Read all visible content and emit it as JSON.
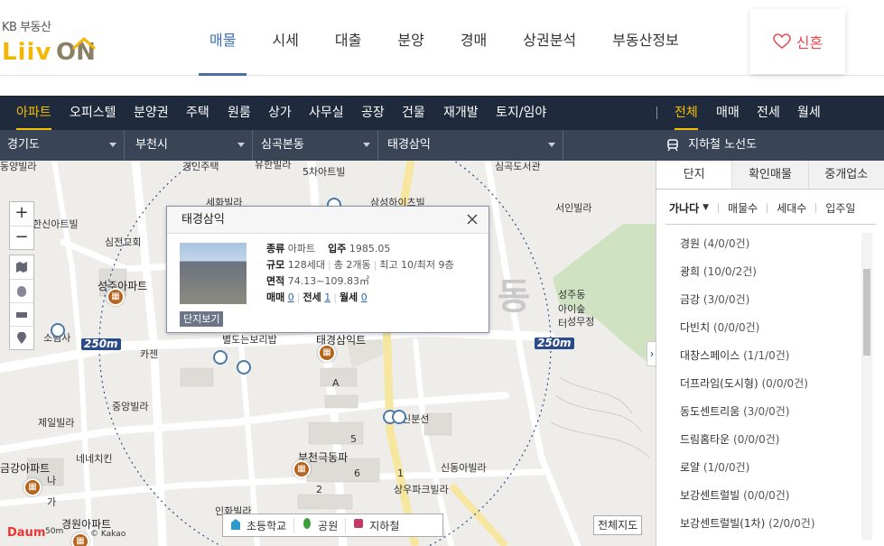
{
  "header": {
    "logo_kb": "KB 부동산",
    "logo_liiv": "Liiv",
    "logo_on": "ON",
    "nav": [
      "매물",
      "시세",
      "대출",
      "분양",
      "경매",
      "상권분석",
      "부동산정보"
    ],
    "active_nav": "매물",
    "user_label": "신혼"
  },
  "categories": {
    "items": [
      "아파트",
      "오피스텔",
      "분양권",
      "주택",
      "원룸",
      "상가",
      "사무실",
      "공장",
      "건물",
      "재개발",
      "토지/임야"
    ],
    "active": "아파트",
    "deal_types": [
      "전체",
      "매매",
      "전세",
      "월세"
    ],
    "active_deal": "전체"
  },
  "filters": {
    "sido": "경기도",
    "sigungu": "부천시",
    "dong": "심곡본동",
    "complex": "태경삼익",
    "subway": "지하철 노선도"
  },
  "map": {
    "labels": {
      "donga": "동양빌라",
      "gyeongin": "경인주택",
      "yuhan": "유한빌라",
      "o_cha": "5차아트빌",
      "simgok_seo": "심곡도서관",
      "sehwa": "세화빌라",
      "samsung": "삼성하이츠빌",
      "seoin": "서인빌라",
      "hanshin": "한신아트빌",
      "simjeon": "심전교회",
      "seongju_apt": "성주아파트",
      "seongju_dong": "성주동아이숲터",
      "seongmu": "성무정",
      "sori": "소림사",
      "kajen": "카젠",
      "bori": "별도는보리밥",
      "taekyung_map": "태경삼익트",
      "jeil": "제일빌라",
      "jungang": "중앙빌라",
      "nene": "네네치킨",
      "bucheon_geukdong": "부천극동파트",
      "sindong": "신동아빌라",
      "sangwoo": "상우파크빌라",
      "geumgang": "금강아파트",
      "na": "나",
      "ga": "가",
      "inhwa": "인화빌라",
      "gyeongwon": "경원아파트",
      "seongbung": "신분선",
      "dong_big": "본 동",
      "a_block": "A",
      "b5": "5",
      "b6": "6",
      "b2": "2",
      "b1": "1"
    },
    "radius_label": "250m",
    "zoom_in": "+",
    "zoom_out": "−",
    "popup": {
      "title": "태경삼익",
      "type_label": "종류",
      "type_value": "아파트",
      "move_label": "입주",
      "move_value": "1985.05",
      "scale_label": "규모",
      "households": "128세대",
      "buildings": "총 2개동",
      "floors": "최고 10/최저 9층",
      "area_label": "면적",
      "area_value": "74.13~109.83㎡",
      "sale_label": "매매",
      "sale_value": "0",
      "jeonse_label": "전세",
      "jeonse_value": "1",
      "monthly_label": "월세",
      "monthly_value": "0",
      "detail_button": "단지보기"
    },
    "legend": [
      "초등학교",
      "공원",
      "지하철"
    ],
    "fullmap_button": "전체지도",
    "brand": "Daum",
    "scale_text": "50m",
    "copyright": "© Kakao"
  },
  "panel": {
    "tabs": [
      "단지",
      "확인매물",
      "중개업소"
    ],
    "active_tab": "단지",
    "sort": [
      "가나다",
      "매물수",
      "세대수",
      "입주일"
    ],
    "complexes": [
      {
        "name": "경원",
        "count": "(4/0/0건)"
      },
      {
        "name": "광희",
        "count": "(10/0/2건)"
      },
      {
        "name": "금강",
        "count": "(3/0/0건)"
      },
      {
        "name": "다빈치",
        "count": "(0/0/0건)"
      },
      {
        "name": "대창스페이스",
        "count": "(1/1/0건)"
      },
      {
        "name": "더프라임(도시형)",
        "count": "(0/0/0건)"
      },
      {
        "name": "동도센트리움",
        "count": "(3/0/0건)"
      },
      {
        "name": "드림홈타운",
        "count": "(0/0/0건)"
      },
      {
        "name": "로얄",
        "count": "(1/0/0건)"
      },
      {
        "name": "보강센트럴빌",
        "count": "(0/0/0건)"
      },
      {
        "name": "보강센트럴빌(1차)",
        "count": "(2/0/0건)"
      }
    ]
  }
}
